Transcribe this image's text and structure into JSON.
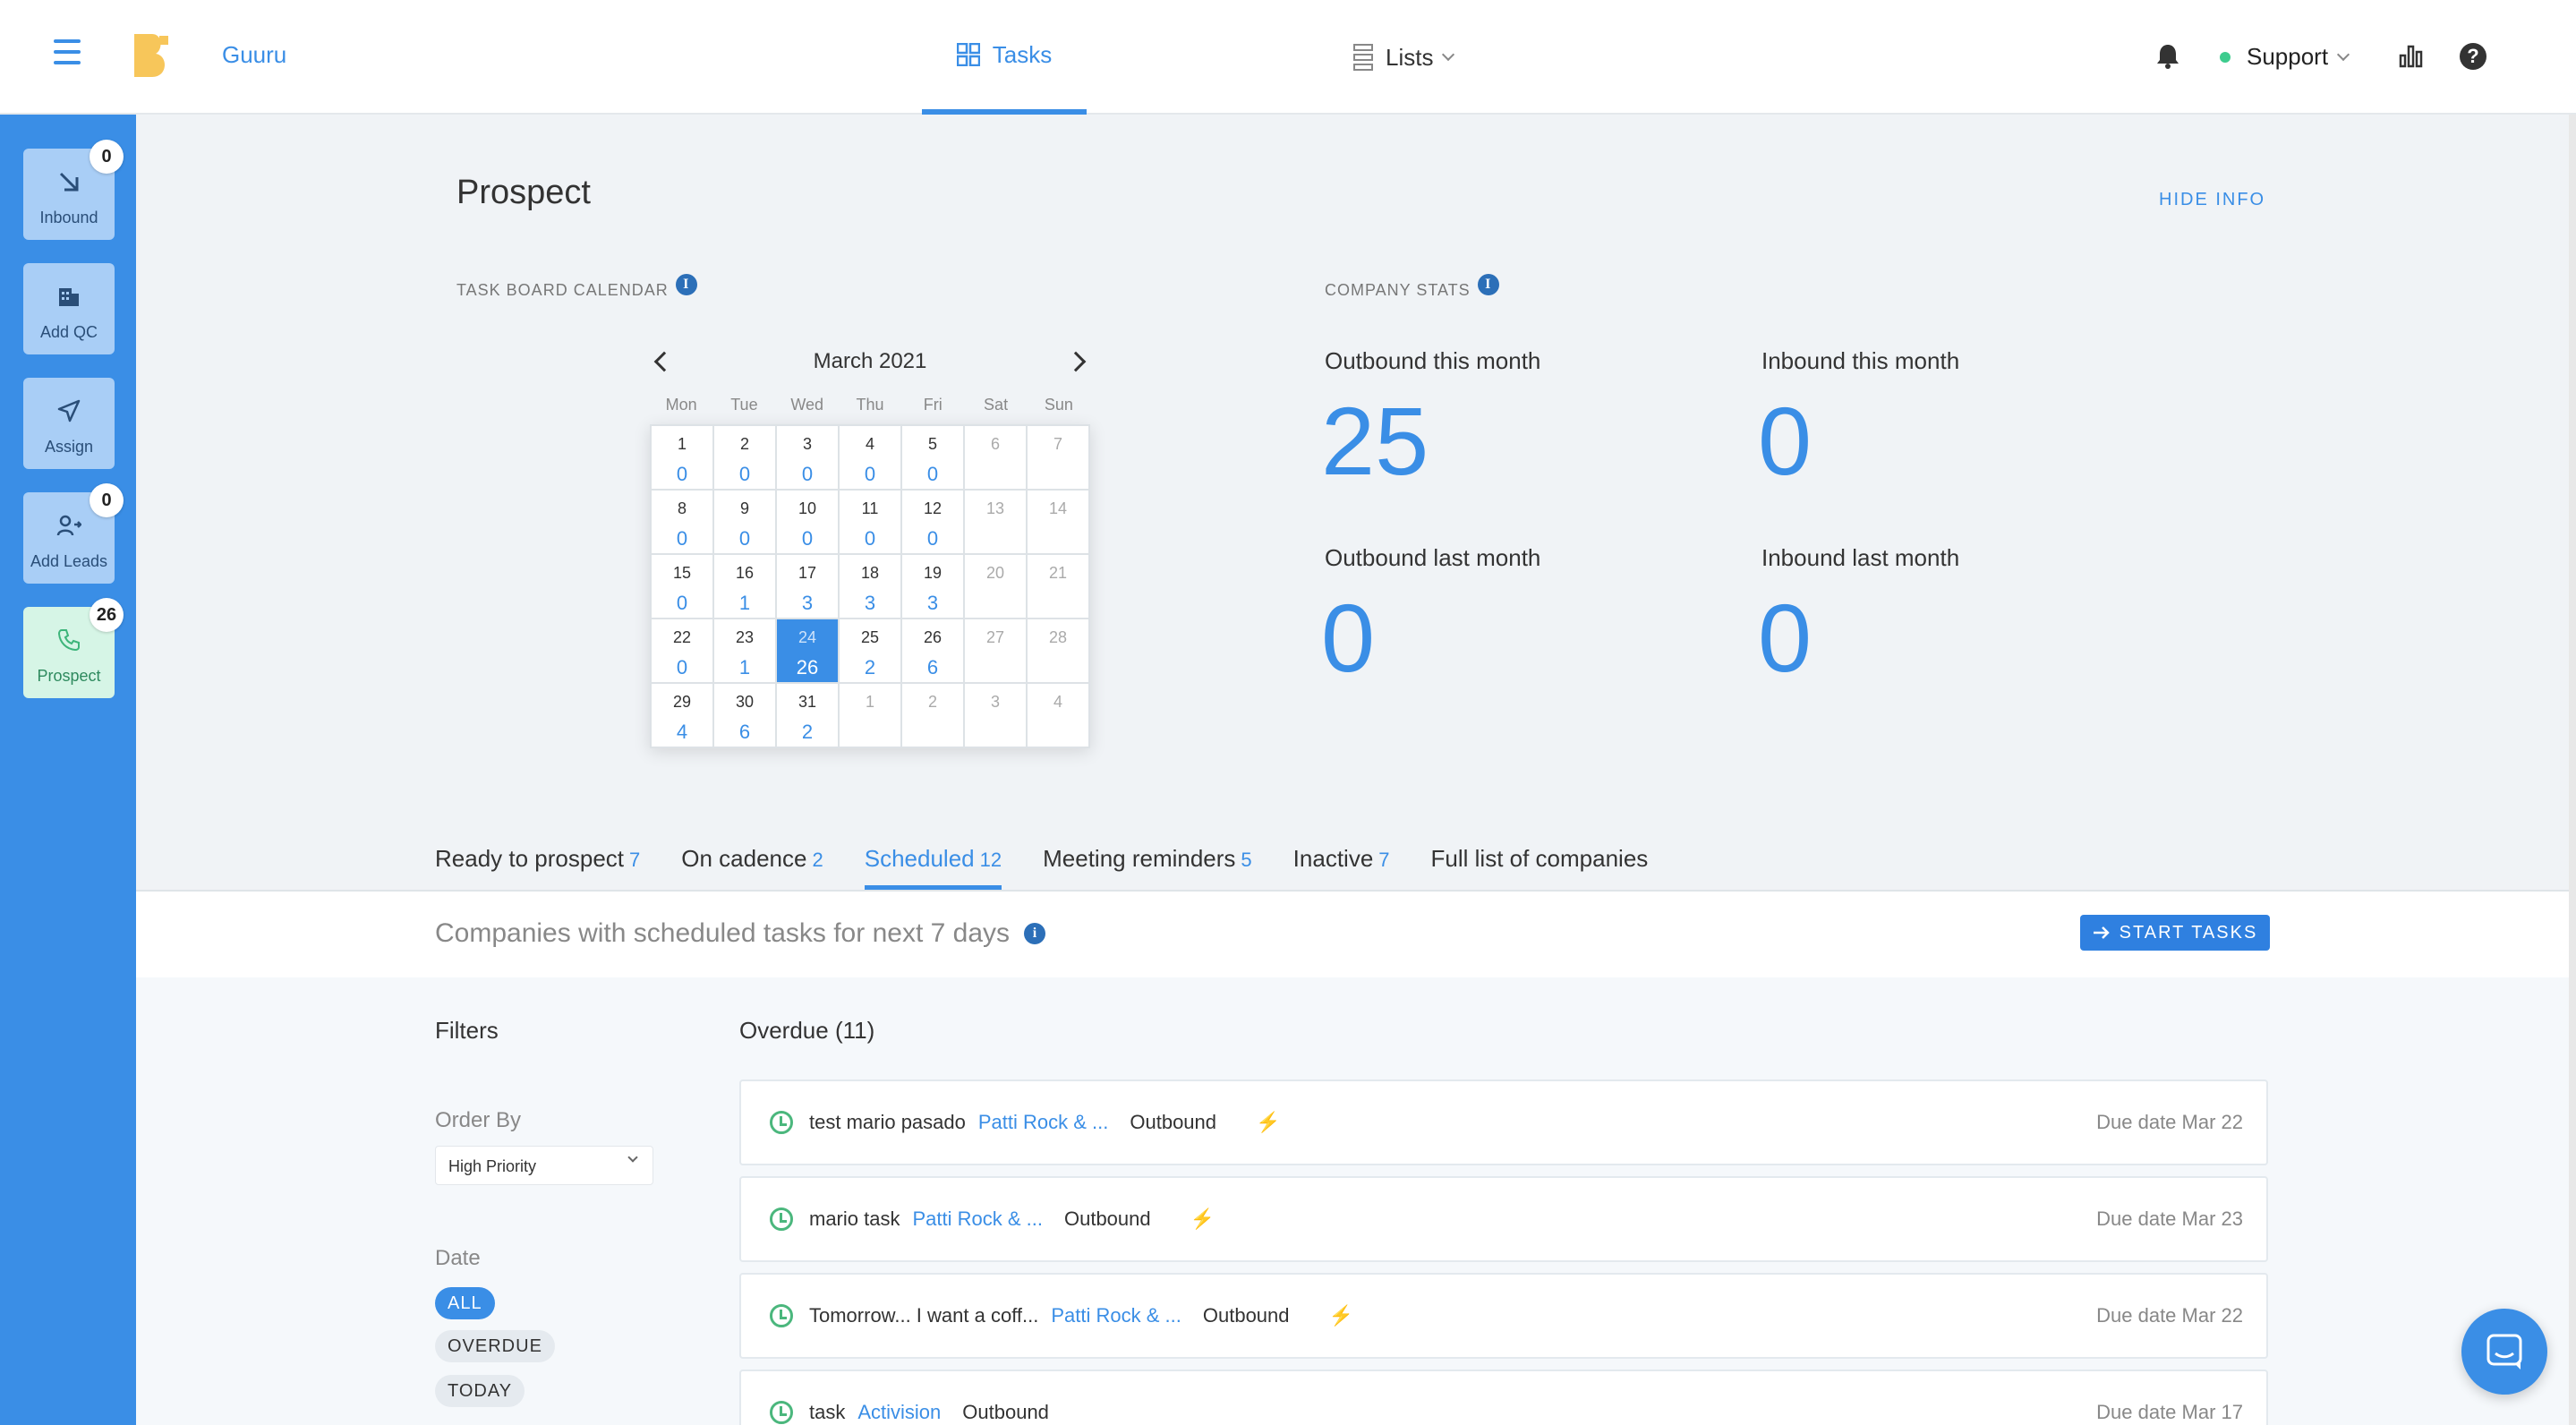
{
  "header": {
    "brand": "Guuru",
    "tabs": [
      {
        "label": "Tasks"
      },
      {
        "label": "Lists"
      }
    ],
    "user": "Support"
  },
  "sidebar": {
    "items": [
      {
        "label": "Inbound",
        "badge": "0",
        "icon": "arrow-down-right-icon"
      },
      {
        "label": "Add QC",
        "icon": "building-icon"
      },
      {
        "label": "Assign",
        "icon": "send-icon"
      },
      {
        "label": "Add Leads",
        "badge": "0",
        "icon": "add-user-icon"
      },
      {
        "label": "Prospect",
        "badge": "26",
        "icon": "phone-icon"
      }
    ]
  },
  "page": {
    "title": "Prospect",
    "hide_info": "HIDE INFO",
    "calendar_label": "TASK BOARD CALENDAR",
    "stats_label": "COMPANY STATS"
  },
  "calendar": {
    "title": "March 2021",
    "days_of_week": [
      "Mon",
      "Tue",
      "Wed",
      "Thu",
      "Fri",
      "Sat",
      "Sun"
    ],
    "cells": [
      {
        "d": "1",
        "n": "0"
      },
      {
        "d": "2",
        "n": "0"
      },
      {
        "d": "3",
        "n": "0"
      },
      {
        "d": "4",
        "n": "0"
      },
      {
        "d": "5",
        "n": "0"
      },
      {
        "d": "6",
        "n": "",
        "muted": true
      },
      {
        "d": "7",
        "n": "",
        "muted": true
      },
      {
        "d": "8",
        "n": "0"
      },
      {
        "d": "9",
        "n": "0"
      },
      {
        "d": "10",
        "n": "0"
      },
      {
        "d": "11",
        "n": "0"
      },
      {
        "d": "12",
        "n": "0"
      },
      {
        "d": "13",
        "n": "",
        "muted": true
      },
      {
        "d": "14",
        "n": "",
        "muted": true
      },
      {
        "d": "15",
        "n": "0"
      },
      {
        "d": "16",
        "n": "1"
      },
      {
        "d": "17",
        "n": "3"
      },
      {
        "d": "18",
        "n": "3"
      },
      {
        "d": "19",
        "n": "3"
      },
      {
        "d": "20",
        "n": "",
        "muted": true
      },
      {
        "d": "21",
        "n": "",
        "muted": true
      },
      {
        "d": "22",
        "n": "0"
      },
      {
        "d": "23",
        "n": "1"
      },
      {
        "d": "24",
        "n": "26",
        "selected": true
      },
      {
        "d": "25",
        "n": "2"
      },
      {
        "d": "26",
        "n": "6"
      },
      {
        "d": "27",
        "n": "",
        "muted": true
      },
      {
        "d": "28",
        "n": "",
        "muted": true
      },
      {
        "d": "29",
        "n": "4"
      },
      {
        "d": "30",
        "n": "6"
      },
      {
        "d": "31",
        "n": "2"
      },
      {
        "d": "1",
        "n": "",
        "muted": true
      },
      {
        "d": "2",
        "n": "",
        "muted": true
      },
      {
        "d": "3",
        "n": "",
        "muted": true
      },
      {
        "d": "4",
        "n": "",
        "muted": true
      }
    ]
  },
  "stats": {
    "outbound_this_month": {
      "label": "Outbound this month",
      "value": "25"
    },
    "inbound_this_month": {
      "label": "Inbound this month",
      "value": "0"
    },
    "outbound_last_month": {
      "label": "Outbound last month",
      "value": "0"
    },
    "inbound_last_month": {
      "label": "Inbound last month",
      "value": "0"
    }
  },
  "tabs": [
    {
      "label": "Ready to prospect",
      "count": "7"
    },
    {
      "label": "On cadence",
      "count": "2"
    },
    {
      "label": "Scheduled",
      "count": "12",
      "active": true
    },
    {
      "label": "Meeting reminders",
      "count": "5"
    },
    {
      "label": "Inactive",
      "count": "7"
    },
    {
      "label": "Full list of companies",
      "count": ""
    }
  ],
  "subheader": {
    "title": "Companies with scheduled tasks for next 7 days",
    "start_button": "START TASKS"
  },
  "filters": {
    "title": "Filters",
    "order_by_label": "Order By",
    "order_by_value": "High Priority",
    "date_label": "Date",
    "date_options": [
      "ALL",
      "OVERDUE",
      "TODAY"
    ]
  },
  "overdue": {
    "title": "Overdue (11)",
    "tasks": [
      {
        "name": "test mario pasado",
        "company": "Patti Rock & ...",
        "type": "Outbound",
        "due": "Due date Mar 22"
      },
      {
        "name": "mario task",
        "company": "Patti Rock & ...",
        "type": "Outbound",
        "due": "Due date Mar 23"
      },
      {
        "name": "Tomorrow... I want a coff...",
        "company": "Patti Rock & ...",
        "type": "Outbound",
        "due": "Due date Mar 22"
      },
      {
        "name": "task",
        "company": "Activision",
        "type": "Outbound",
        "due": "Due date Mar 17"
      }
    ]
  },
  "colors": {
    "accent": "#3a8ee6",
    "sidebar": "#3a8ee6",
    "online": "#3dcc8e",
    "bolt": "#f4b33b"
  }
}
